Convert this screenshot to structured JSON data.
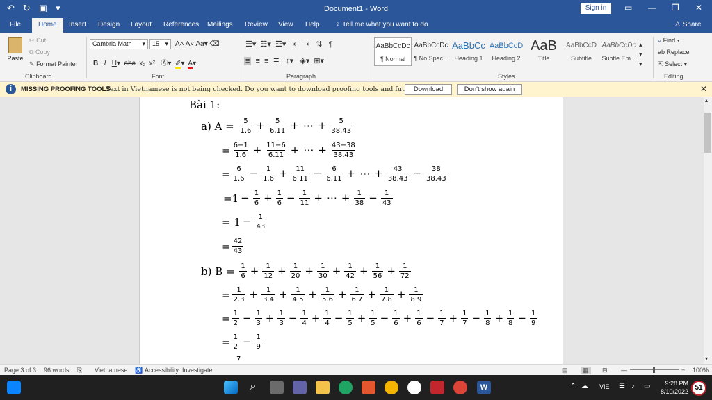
{
  "app": {
    "title": "Document1  -  Word",
    "signin": "Sign in",
    "colors": {
      "brand": "#2b579a",
      "infobar": "#fff4ce"
    }
  },
  "tabs": [
    "File",
    "Home",
    "Insert",
    "Design",
    "Layout",
    "References",
    "Mailings",
    "Review",
    "View",
    "Help"
  ],
  "tell_me": "Tell me what you want to do",
  "share": "Share",
  "clipboard": {
    "paste": "Paste",
    "cut": "Cut",
    "copy": "Copy",
    "format_painter": "Format Painter",
    "label": "Clipboard"
  },
  "font": {
    "name": "Cambria Math",
    "size": "15",
    "label": "Font"
  },
  "paragraph": {
    "label": "Paragraph"
  },
  "styles": {
    "items": [
      {
        "preview": "AaBbCcDc",
        "label": "¶ Normal"
      },
      {
        "preview": "AaBbCcDc",
        "label": "¶ No Spac..."
      },
      {
        "preview": "AaBbCc",
        "label": "Heading 1"
      },
      {
        "preview": "AaBbCcD",
        "label": "Heading 2"
      },
      {
        "preview": "AaB",
        "label": "Title"
      },
      {
        "preview": "AaBbCcD",
        "label": "Subtitle"
      },
      {
        "preview": "AaBbCcDc",
        "label": "Subtle Em..."
      }
    ],
    "label": "Styles"
  },
  "editing": {
    "find": "Find",
    "replace": "Replace",
    "select": "Select",
    "label": "Editing"
  },
  "infobar": {
    "heading": "MISSING PROOFING TOOLS",
    "message": "Text in Vietnamese is not being checked. Do you want to download proofing tools and future updates?",
    "download": "Download",
    "dont_show": "Don't show again"
  },
  "doc": {
    "heading": "Bài 1:",
    "a_label": "a) A =",
    "b_label": "b) B =",
    "eq": "=",
    "eq_one": "=1",
    "one": "1",
    "plus": "+",
    "minus": "−",
    "dots": "⋯",
    "trailing": "7",
    "a1": [
      [
        "5",
        "1.6"
      ],
      [
        "5",
        "6.11"
      ],
      [
        "5",
        "38.43"
      ]
    ],
    "a2": [
      [
        "6−1",
        "1.6"
      ],
      [
        "11−6",
        "6.11"
      ],
      [
        "43−38",
        "38.43"
      ]
    ],
    "a3": [
      [
        "6",
        "1.6"
      ],
      [
        "1",
        "1.6"
      ],
      [
        "11",
        "6.11"
      ],
      [
        "6",
        "6.11"
      ],
      [
        "43",
        "38.43"
      ],
      [
        "38",
        "38.43"
      ]
    ],
    "a4": [
      [
        "1",
        "6"
      ],
      [
        "1",
        "6"
      ],
      [
        "1",
        "11"
      ],
      [
        "1",
        "38"
      ],
      [
        "1",
        "43"
      ]
    ],
    "a5": [
      [
        "1",
        "43"
      ]
    ],
    "a6": [
      [
        "42",
        "43"
      ]
    ],
    "b1": [
      [
        "1",
        "6"
      ],
      [
        "1",
        "12"
      ],
      [
        "1",
        "20"
      ],
      [
        "1",
        "30"
      ],
      [
        "1",
        "42"
      ],
      [
        "1",
        "56"
      ],
      [
        "1",
        "72"
      ]
    ],
    "b2": [
      [
        "1",
        "2.3"
      ],
      [
        "1",
        "3.4"
      ],
      [
        "1",
        "4.5"
      ],
      [
        "1",
        "5.6"
      ],
      [
        "1",
        "6.7"
      ],
      [
        "1",
        "7.8"
      ],
      [
        "1",
        "8.9"
      ]
    ],
    "b3": [
      [
        "1",
        "2"
      ],
      [
        "1",
        "3"
      ],
      [
        "1",
        "3"
      ],
      [
        "1",
        "4"
      ],
      [
        "1",
        "4"
      ],
      [
        "1",
        "5"
      ],
      [
        "1",
        "5"
      ],
      [
        "1",
        "6"
      ],
      [
        "1",
        "6"
      ],
      [
        "1",
        "7"
      ],
      [
        "1",
        "7"
      ],
      [
        "1",
        "8"
      ],
      [
        "1",
        "8"
      ],
      [
        "1",
        "9"
      ]
    ],
    "b4": [
      [
        "1",
        "2"
      ],
      [
        "1",
        "9"
      ]
    ]
  },
  "status": {
    "page": "Page 3 of 3",
    "words": "96 words",
    "language": "Vietnamese",
    "accessibility": "Accessibility: Investigate",
    "zoom": "100%"
  },
  "taskbar": {
    "lang": "VIE",
    "time": "9:28 PM",
    "date": "8/10/2022",
    "badge": "51"
  }
}
